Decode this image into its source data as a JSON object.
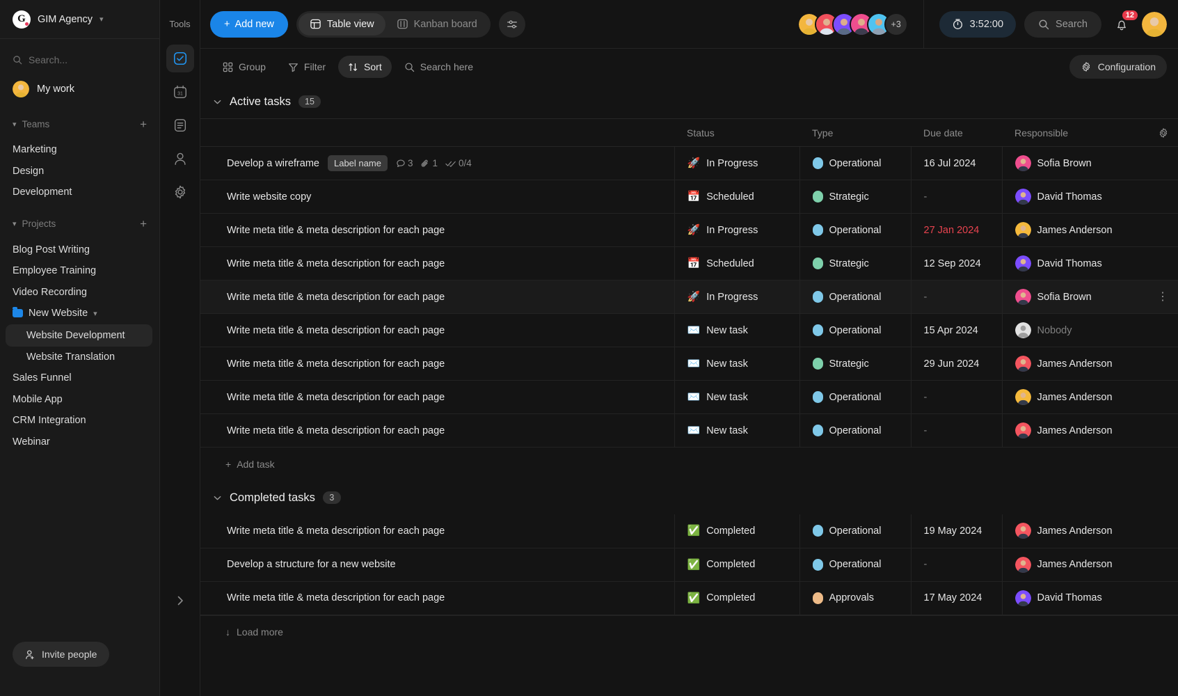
{
  "sidebar": {
    "brand": {
      "logo_letter": "G",
      "name": "GIM Agency",
      "caret": "chevron-down"
    },
    "search_placeholder": "Search...",
    "my_work": "My work",
    "teams": {
      "title": "Teams",
      "add": "+",
      "items": [
        "Marketing",
        "Design",
        "Development"
      ]
    },
    "projects": {
      "title": "Projects",
      "add": "+",
      "items": [
        {
          "label": "Blog Post Writing",
          "type": "project"
        },
        {
          "label": "Employee Training",
          "type": "project"
        },
        {
          "label": "Video Recording",
          "type": "project"
        },
        {
          "label": "New Website",
          "type": "folder",
          "expanded": true
        },
        {
          "label": "Website Development",
          "type": "sub",
          "active": true
        },
        {
          "label": "Website Translation",
          "type": "sub",
          "active": false
        },
        {
          "label": "Sales Funnel",
          "type": "project"
        },
        {
          "label": "Mobile App",
          "type": "project"
        },
        {
          "label": "CRM Integration",
          "type": "project"
        },
        {
          "label": "Webinar",
          "type": "project"
        }
      ]
    },
    "invite_label": "Invite people"
  },
  "rail": {
    "title": "Tools",
    "items": [
      {
        "name": "tasks-icon",
        "active": true
      },
      {
        "name": "calendar-icon",
        "active": false
      },
      {
        "name": "notes-icon",
        "active": false
      },
      {
        "name": "contacts-icon",
        "active": false
      },
      {
        "name": "settings-icon",
        "active": false
      }
    ],
    "expand": "chevron-right"
  },
  "topbar": {
    "add_new": "Add new",
    "views": [
      {
        "label": "Table view",
        "active": true
      },
      {
        "label": "Kanban board",
        "active": false
      }
    ],
    "view_settings_icon": "sliders-icon",
    "avatars_overflow": "+3",
    "timer": "3:52:00",
    "search": "Search",
    "notifications_count": "12"
  },
  "filterbar": {
    "group": "Group",
    "filter": "Filter",
    "sort": "Sort",
    "search_here": "Search here",
    "configuration": "Configuration"
  },
  "table": {
    "columns": [
      "Status",
      "Type",
      "Due date",
      "Responsible"
    ],
    "groups": [
      {
        "title": "Active tasks",
        "count": "15",
        "add_task": "Add task",
        "rows": [
          {
            "task": "Develop a wireframe",
            "label": "Label name",
            "comments": "3",
            "attachments": "1",
            "subtasks": "0/4",
            "status": "In Progress",
            "status_icon": "🚀",
            "type": "Operational",
            "type_color": "#7fc8e8",
            "due": "16 Jul 2024",
            "overdue": false,
            "responsible": "Sofia Brown",
            "avatar_color": "#ef4e8e",
            "hover": false,
            "type_selected": false
          },
          {
            "task": "Write website copy",
            "label": "",
            "status": "Scheduled",
            "status_icon": "📅",
            "type": "Strategic",
            "type_color": "#7ed0ab",
            "due": "-",
            "overdue": false,
            "responsible": "David Thomas",
            "avatar_color": "#7c4dff",
            "hover": false,
            "type_selected": false
          },
          {
            "task": "Write meta title & meta description for each page",
            "label": "",
            "status": "In Progress",
            "status_icon": "🚀",
            "type": "Operational",
            "type_color": "#7fc8e8",
            "due": "27 Jan 2024",
            "overdue": true,
            "responsible": "James Anderson",
            "avatar_color": "#f5b93c",
            "hover": false,
            "type_selected": false
          },
          {
            "task": "Write meta title & meta description for each page",
            "label": "",
            "status": "Scheduled",
            "status_icon": "📅",
            "type": "Strategic",
            "type_color": "#7ed0ab",
            "due": "12 Sep 2024",
            "overdue": false,
            "responsible": "David Thomas",
            "avatar_color": "#7c4dff",
            "hover": false,
            "type_selected": false
          },
          {
            "task": "Write meta title & meta description for each page",
            "label": "",
            "status": "In Progress",
            "status_icon": "🚀",
            "type": "Operational",
            "type_color": "#7fc8e8",
            "due": "-",
            "overdue": false,
            "responsible": "Sofia Brown",
            "avatar_color": "#ef4e8e",
            "hover": true,
            "type_selected": true
          },
          {
            "task": "Write meta title & meta description for each page",
            "label": "",
            "status": "New task",
            "status_icon": "✉️",
            "type": "Operational",
            "type_color": "#7fc8e8",
            "due": "15 Apr 2024",
            "overdue": false,
            "responsible": "Nobody",
            "avatar_color": "#d0d0d0",
            "nobody": true,
            "hover": false,
            "type_selected": false
          },
          {
            "task": "Write meta title & meta description for each page",
            "label": "",
            "status": "New task",
            "status_icon": "✉️",
            "type": "Strategic",
            "type_color": "#7ed0ab",
            "due": "29 Jun 2024",
            "overdue": false,
            "responsible": "James Anderson",
            "avatar_color": "#f4555f",
            "hover": false,
            "type_selected": false
          },
          {
            "task": "Write meta title & meta description for each page",
            "label": "",
            "status": "New task",
            "status_icon": "✉️",
            "type": "Operational",
            "type_color": "#7fc8e8",
            "due": "-",
            "overdue": false,
            "responsible": "James Anderson",
            "avatar_color": "#f5b93c",
            "hover": false,
            "type_selected": false
          },
          {
            "task": "Write meta title & meta description for each page",
            "label": "",
            "status": "New task",
            "status_icon": "✉️",
            "type": "Operational",
            "type_color": "#7fc8e8",
            "due": "-",
            "overdue": false,
            "responsible": "James Anderson",
            "avatar_color": "#f4555f",
            "hover": false,
            "type_selected": false
          }
        ]
      },
      {
        "title": "Completed tasks",
        "count": "3",
        "load_more": "Load more",
        "rows": [
          {
            "task": "Write meta title & meta description for each page",
            "label": "",
            "status": "Completed",
            "status_icon": "✅",
            "type": "Operational",
            "type_color": "#7fc8e8",
            "due": "19 May 2024",
            "overdue": false,
            "responsible": "James Anderson",
            "avatar_color": "#f4555f",
            "hover": false,
            "type_selected": false
          },
          {
            "task": "Develop a structure for a new website",
            "label": "",
            "status": "Completed",
            "status_icon": "✅",
            "type": "Operational",
            "type_color": "#7fc8e8",
            "due": "-",
            "overdue": false,
            "responsible": "James Anderson",
            "avatar_color": "#f4555f",
            "hover": false,
            "type_selected": false
          },
          {
            "task": "Write meta title & meta description for each page",
            "label": "",
            "status": "Completed",
            "status_icon": "✅",
            "type": "Approvals",
            "type_color": "#eebb88",
            "due": "17 May 2024",
            "overdue": false,
            "responsible": "David Thomas",
            "avatar_color": "#7c4dff",
            "hover": false,
            "type_selected": false
          }
        ]
      }
    ]
  },
  "colors": {
    "accent": "#1a85e8",
    "overdue": "#e8434f",
    "badge": "#e8394a",
    "folder": "#1d87e8",
    "rail_active": "#2196f3"
  }
}
